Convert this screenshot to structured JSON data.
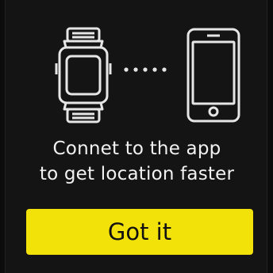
{
  "message": {
    "line1": "Connet to the app",
    "line2": "to get location faster"
  },
  "button": {
    "label": "Got it"
  },
  "icons": {
    "watch": "smartwatch-icon",
    "connection": "dotted-connection-icon",
    "phone": "smartphone-icon"
  },
  "colors": {
    "background": "#141414",
    "text": "#f2f2f2",
    "button": "#f2e20a",
    "button_text": "#111111"
  }
}
